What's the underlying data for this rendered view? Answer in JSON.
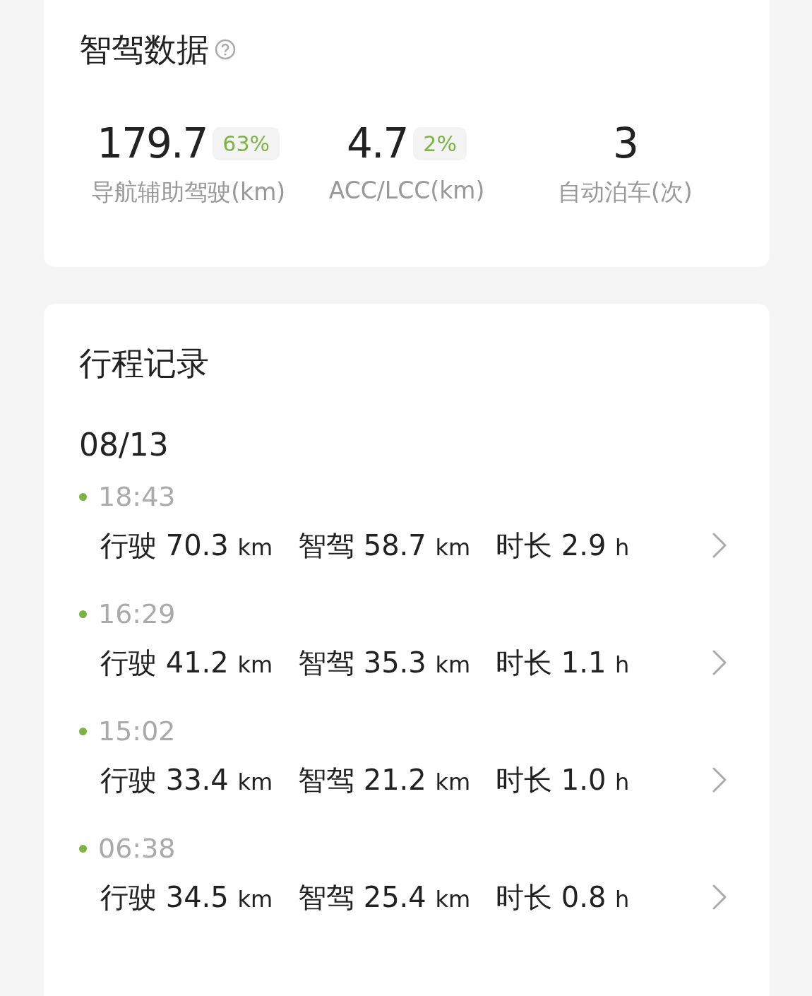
{
  "stats_card": {
    "title": "智驾数据",
    "stats": [
      {
        "value": "179.7",
        "badge": "63%",
        "label": "导航辅助驾驶(km)"
      },
      {
        "value": "4.7",
        "badge": "2%",
        "label": "ACC/LCC(km)"
      },
      {
        "value": "3",
        "label": "自动泊车(次)"
      }
    ]
  },
  "trips_card": {
    "title": "行程记录",
    "date": "08/13",
    "trips": [
      {
        "time": "18:43",
        "metrics": [
          {
            "label": "行驶",
            "value": "70.3",
            "unit": "km"
          },
          {
            "label": "智驾",
            "value": "58.7",
            "unit": "km"
          },
          {
            "label": "时长",
            "value": "2.9",
            "unit": "h"
          }
        ]
      },
      {
        "time": "16:29",
        "metrics": [
          {
            "label": "行驶",
            "value": "41.2",
            "unit": "km"
          },
          {
            "label": "智驾",
            "value": "35.3",
            "unit": "km"
          },
          {
            "label": "时长",
            "value": "1.1",
            "unit": "h"
          }
        ]
      },
      {
        "time": "15:02",
        "metrics": [
          {
            "label": "行驶",
            "value": "33.4",
            "unit": "km"
          },
          {
            "label": "智驾",
            "value": "21.2",
            "unit": "km"
          },
          {
            "label": "时长",
            "value": "1.0",
            "unit": "h"
          }
        ]
      },
      {
        "time": "06:38",
        "metrics": [
          {
            "label": "行驶",
            "value": "34.5",
            "unit": "km"
          },
          {
            "label": "智驾",
            "value": "25.4",
            "unit": "km"
          },
          {
            "label": "时长",
            "value": "0.8",
            "unit": "h"
          }
        ]
      }
    ]
  }
}
